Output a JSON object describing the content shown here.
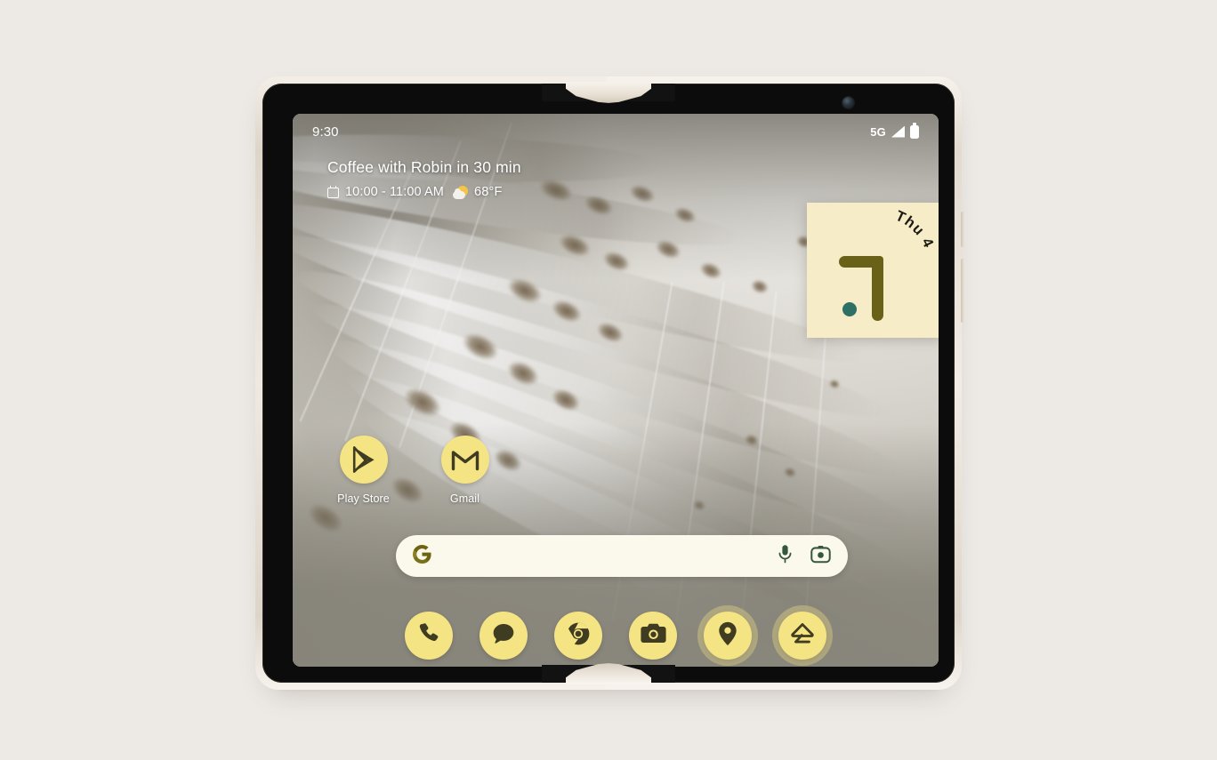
{
  "page": {
    "background_color": "#edeae6",
    "device_name": "Google Pixel Fold",
    "device_frame_color": "#eee8df"
  },
  "status_bar": {
    "time": "9:30",
    "network_type": "5G",
    "signal_icon": "signal-bars-icon",
    "battery_icon": "battery-full-icon"
  },
  "at_a_glance": {
    "title": "Coffee with Robin in 30 min",
    "calendar_icon": "calendar-icon",
    "event_time": "10:00 - 11:00 AM",
    "weather_icon": "sun-behind-cloud-icon",
    "temperature": "68°F"
  },
  "clock_widget": {
    "date_label": "Thu 4",
    "time_shown": "9:30",
    "background_color": "#f6edc8",
    "hand_color": "#6a6119",
    "dot_color": "#2f7064",
    "shape": "scalloped-blob"
  },
  "apps": [
    {
      "label": "Play Store",
      "icon": "play-store-icon"
    },
    {
      "label": "Gmail",
      "icon": "gmail-icon"
    }
  ],
  "search": {
    "placeholder": "",
    "value": "",
    "google_icon": "google-g-icon",
    "mic_icon": "microphone-icon",
    "lens_icon": "google-lens-camera-icon",
    "background_color": "#fbf8ec"
  },
  "dock": [
    {
      "label": "Phone",
      "icon": "phone-icon",
      "ringed": false
    },
    {
      "label": "Messages",
      "icon": "messages-chat-bubble-icon",
      "ringed": false
    },
    {
      "label": "Chrome",
      "icon": "chrome-icon",
      "ringed": false
    },
    {
      "label": "Camera",
      "icon": "camera-icon",
      "ringed": false
    },
    {
      "label": "Maps",
      "icon": "maps-pin-icon",
      "ringed": true
    },
    {
      "label": "Home",
      "icon": "google-home-icon",
      "ringed": true
    }
  ],
  "theme": {
    "accent_yellow": "#f5e483",
    "glyph_color": "#403c21",
    "wallpaper": "bird-wing-feathers"
  }
}
